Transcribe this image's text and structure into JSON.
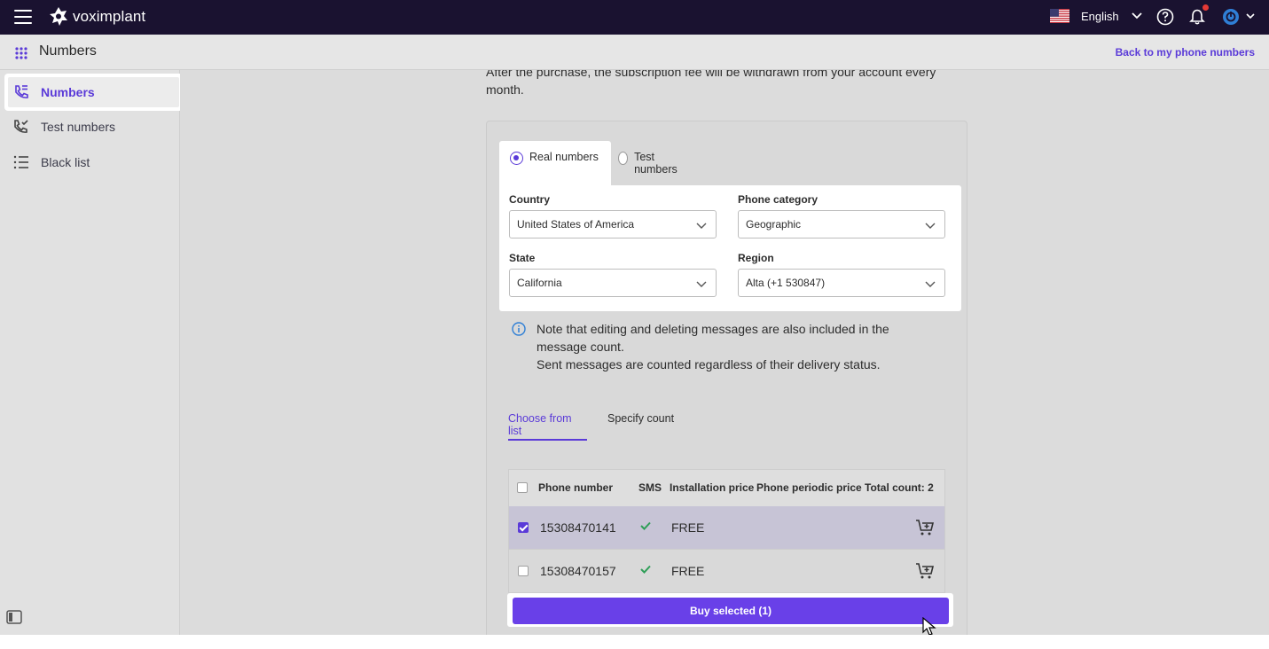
{
  "topbar": {
    "brand": "voximplant",
    "language": "English",
    "icons": [
      "menu-icon",
      "help-icon",
      "bell-icon",
      "account-icon"
    ]
  },
  "subheader": {
    "title": "Numbers",
    "back_link": "Back to my phone numbers"
  },
  "sidebar": {
    "items": [
      {
        "label": "Numbers",
        "icon": "phone-numbers-icon",
        "active": true
      },
      {
        "label": "Test numbers",
        "icon": "test-phone-icon",
        "active": false
      },
      {
        "label": "Black list",
        "icon": "list-icon",
        "active": false
      }
    ]
  },
  "main": {
    "intro": "After the purchase, the subscription fee will be withdrawn from your account every month.",
    "number_type_tabs": [
      {
        "label": "Real numbers",
        "selected": true
      },
      {
        "label": "Test numbers",
        "selected": false
      }
    ],
    "form": {
      "country": {
        "label": "Country",
        "value": "United States of America"
      },
      "category": {
        "label": "Phone category",
        "value": "Geographic"
      },
      "state": {
        "label": "State",
        "value": "California"
      },
      "region": {
        "label": "Region",
        "value": "Alta (+1 530847)"
      }
    },
    "note": {
      "line1": "Note that editing and deleting messages are also included in the message count.",
      "line2": "Sent messages are counted regardless of their delivery status."
    },
    "choose_tabs": [
      {
        "label": "Choose from list",
        "active": true
      },
      {
        "label": "Specify count",
        "active": false
      }
    ],
    "table": {
      "headers": {
        "phone": "Phone number",
        "sms": "SMS",
        "install": "Installation price",
        "periodic": "Phone periodic price",
        "total": "Total count: 2"
      },
      "rows": [
        {
          "number": "15308470141",
          "sms": true,
          "install": "FREE",
          "periodic": "",
          "checked": true
        },
        {
          "number": "15308470157",
          "sms": true,
          "install": "FREE",
          "periodic": "",
          "checked": false
        }
      ]
    },
    "buy_button": "Buy selected (1)"
  },
  "colors": {
    "accent": "#5a3ad8",
    "topbar": "#1a1230",
    "button": "#6940e8",
    "check": "#2e9e57"
  }
}
